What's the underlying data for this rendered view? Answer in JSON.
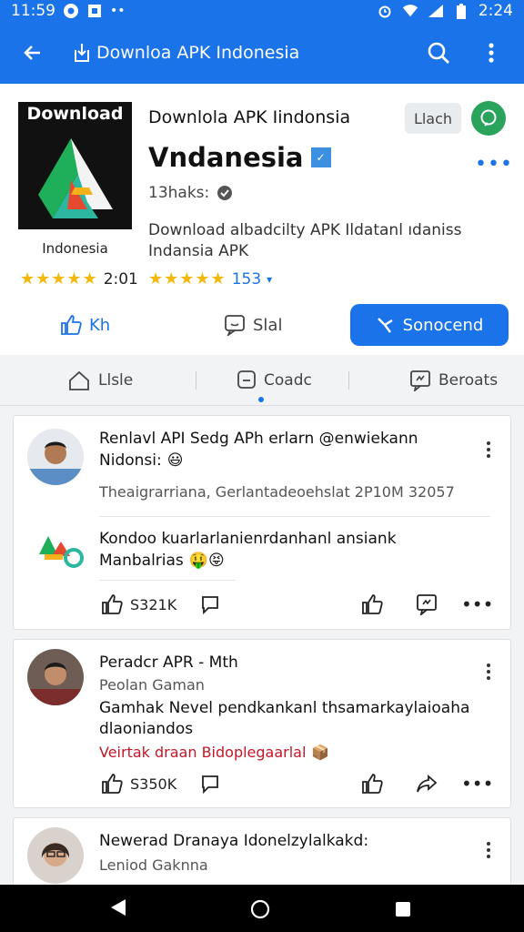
{
  "status_bar": {
    "time_left": "11:59",
    "time_right": "2:24",
    "colors": {
      "bar": "#1a73e8"
    }
  },
  "app_bar": {
    "title": "Downloa APK Indonesia",
    "icons": [
      "back-arrow-icon",
      "download-icon",
      "search-icon",
      "more-vert-icon"
    ]
  },
  "app": {
    "icon_brand": "Download",
    "icon_caption": "Indonesia",
    "name_small": "Downlola APK Iindonsia",
    "name_big": "Vndanesia",
    "subscribers": "13haks:",
    "description": "Download albadcilty APK Ildatanl ıdaniss Indansia APK",
    "chip_label": "Llach",
    "rating_left": {
      "stars": "★★★★★",
      "value": "2:01"
    },
    "rating_right": {
      "stars": "★★★★★",
      "value": "153",
      "fraction_filled": 0.8
    }
  },
  "actions": {
    "like_label": "Kh",
    "share_label": "Slal",
    "primary_label": "Sonocend"
  },
  "tabs": [
    {
      "label": "Llsle",
      "icon": "home-icon"
    },
    {
      "label": "Coadc",
      "icon": "chat-icon"
    },
    {
      "label": "Beroats",
      "icon": "report-icon"
    }
  ],
  "posts": [
    {
      "title": "Renlavl API Sedg APh erlarn @enwiekann",
      "title2": "Nidonsi:",
      "emojis": "😃",
      "meta": "Theaigrarriana, Gerlantadeoehslat 2P10M 32057",
      "reply_title": "Kondoo kuarlarlanienrdanhanl ansiank",
      "reply_title2": "Manbalrias",
      "reply_emojis": "🤑😝",
      "like_count": "S321K"
    },
    {
      "title": "Peradcr APR - Mth",
      "meta": "Peolan Gaman",
      "body": "Gamhak Nevel pendkankanl thsamarkaylaioaha dlaoniandos",
      "red_text": "Veirtak draan Bidoplegaarlal",
      "like_count": "S350K"
    },
    {
      "title": "Newerad Dranaya Idonelzylalkakd:",
      "meta": "Leniod Gaknna"
    }
  ]
}
